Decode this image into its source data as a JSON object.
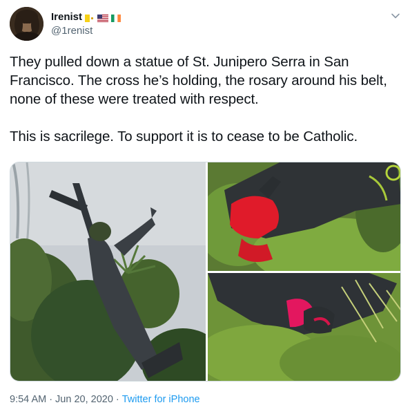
{
  "author": {
    "display_name": "Irenist",
    "handle": "@1renist",
    "flags": [
      "vatican-flag-icon",
      "us-flag-icon",
      "ireland-flag-icon"
    ]
  },
  "tweet": {
    "text": "They pulled down a statue of St. Junipero Serra in San Francisco. The cross he’s holding, the rosary around his belt, none of these were treated with respect.\n\nThis is sacrilege. To support it is to cease to be Catholic.",
    "media": [
      {
        "name": "statue-falling-photo"
      },
      {
        "name": "statue-hands-red-paint-photo"
      },
      {
        "name": "statue-feet-red-paint-photo"
      }
    ]
  },
  "meta": {
    "time": "9:54 AM",
    "separator1": "·",
    "date": "Jun 20, 2020",
    "separator2": "·",
    "source": "Twitter for iPhone"
  },
  "colors": {
    "text": "#0f1419",
    "secondary": "#536471",
    "link": "#1d9bf0",
    "border": "#cfd9de"
  }
}
